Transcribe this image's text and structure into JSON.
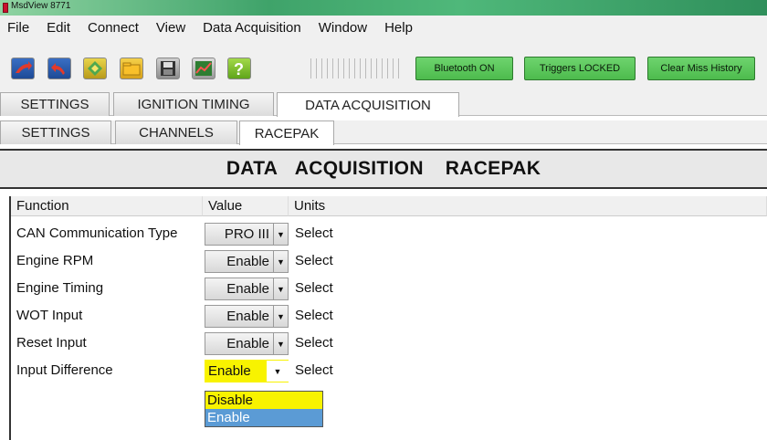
{
  "window": {
    "title": "MsdView  8771"
  },
  "menu": [
    "File",
    "Edit",
    "Connect",
    "View",
    "Data Acquisition",
    "Window",
    "Help"
  ],
  "toolbar": {
    "bluetooth_label": "Bluetooth ON",
    "triggers_label": "Triggers LOCKED",
    "clear_label": "Clear Miss History"
  },
  "main_tabs": [
    "SETTINGS",
    "IGNITION TIMING",
    "DATA ACQUISITION"
  ],
  "sub_tabs": [
    "SETTINGS",
    "CHANNELS",
    "RACEPAK"
  ],
  "header": {
    "left": "DATA ACQUISITION",
    "right": "RACEPAK"
  },
  "grid": {
    "columns": [
      "Function",
      "Value",
      "Units"
    ],
    "rows": [
      {
        "function": "CAN Communication Type",
        "value": "PRO III",
        "units": "Select"
      },
      {
        "function": "Engine RPM",
        "value": "Enable",
        "units": "Select"
      },
      {
        "function": "Engine Timing",
        "value": "Enable",
        "units": "Select"
      },
      {
        "function": "WOT Input",
        "value": "Enable",
        "units": "Select"
      },
      {
        "function": "Reset Input",
        "value": "Enable",
        "units": "Select"
      },
      {
        "function": "Input Difference",
        "value": "Enable",
        "units": "Select"
      }
    ]
  },
  "dropdown": {
    "options": [
      "Disable",
      "Enable"
    ],
    "selected": "Enable"
  },
  "colors": {
    "highlight_yellow": "#f8f300",
    "selection_blue": "#5b9bd5",
    "button_green": "#5ec85e"
  }
}
